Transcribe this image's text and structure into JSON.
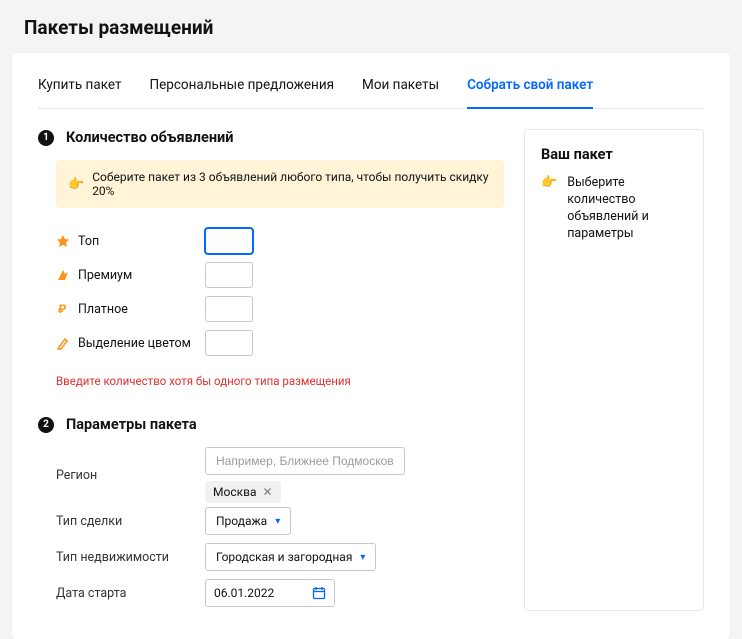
{
  "page": {
    "title": "Пакеты размещений"
  },
  "tabs": {
    "buy": "Купить пакет",
    "offers": "Персональные предложения",
    "mine": "Мои пакеты",
    "build": "Собрать свой пакет"
  },
  "section1": {
    "step": "1",
    "title": "Количество объявлений",
    "tip": "Соберите пакет из 3 объявлений любого типа, чтобы получить скидку 20%",
    "rows": {
      "top": "Топ",
      "premium": "Премиум",
      "paid": "Платное",
      "highlight": "Выделение цветом"
    },
    "error": "Введите количество хотя бы одного типа размещения"
  },
  "section2": {
    "step": "2",
    "title": "Параметры пакета",
    "region_label": "Регион",
    "region_placeholder": "Например, Ближнее Подмосковье",
    "region_chip": "Москва",
    "deal_label": "Тип сделки",
    "deal_value": "Продажа",
    "realty_label": "Тип недвижимости",
    "realty_value": "Городская и загородная",
    "date_label": "Дата старта",
    "date_value": "06.01.2022"
  },
  "sidebox": {
    "title": "Ваш пакет",
    "text": "Выберите количество объявлений и параметры"
  }
}
